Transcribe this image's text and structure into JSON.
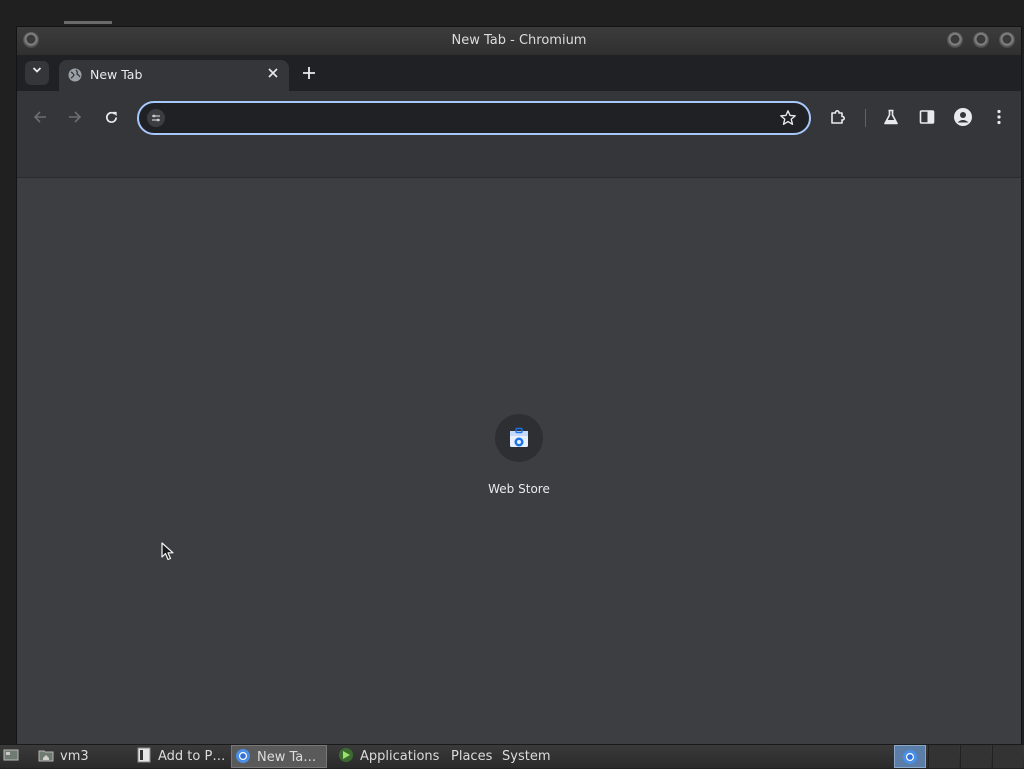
{
  "window": {
    "title": "New Tab - Chromium"
  },
  "tabs": [
    {
      "title": "New Tab",
      "active": true
    }
  ],
  "toolbar": {
    "address_value": "",
    "address_placeholder": ""
  },
  "content": {
    "shortcuts": [
      {
        "label": "Web Store",
        "icon": "web-store-icon"
      }
    ]
  },
  "taskbar": {
    "items": [
      {
        "label": "vm3",
        "icon": "folder-home-icon"
      },
      {
        "label": "Add to P…",
        "icon": "document-icon"
      },
      {
        "label": "New Ta…",
        "icon": "chromium-icon",
        "active": true
      }
    ],
    "menus": [
      {
        "label": "Applications",
        "icon": "applications-icon"
      },
      {
        "label": "Places"
      },
      {
        "label": "System"
      }
    ]
  },
  "colors": {
    "accent": "#a8c7fa",
    "tab_strip": "#202124",
    "toolbar": "#35363a",
    "content": "#3d3e42"
  }
}
